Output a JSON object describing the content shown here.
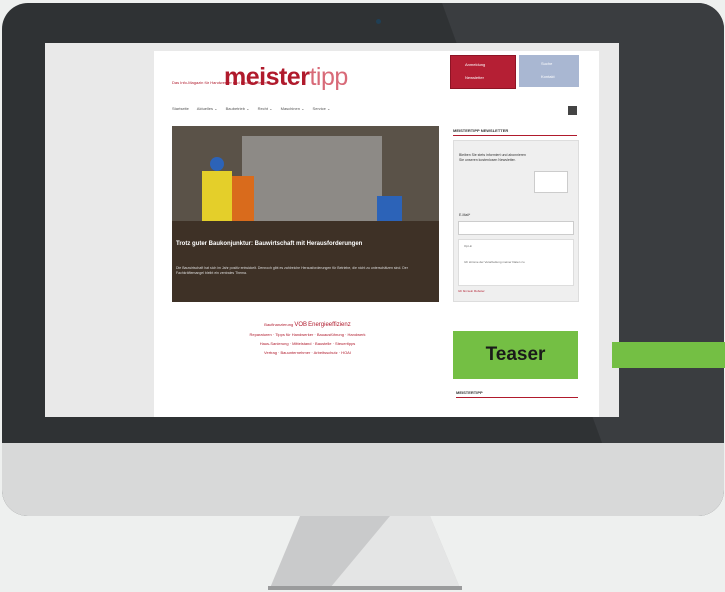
{
  "site": {
    "logo_part1": "meister",
    "logo_part2": "tipp",
    "tagline": "Das Info-Magazin für Handwerker und Bauunternehmer",
    "nav": [
      "Startseite",
      "Aktuelles ⌄",
      "Baubetrieb ⌄",
      "Recht ⌄",
      "Maschinen ⌄",
      "Service ⌄"
    ],
    "header_buttons_red": [
      "Anmeldung",
      "Newsletter"
    ],
    "header_buttons_blue": [
      "Suche",
      "Kontakt"
    ]
  },
  "hero": {
    "title": "Trotz guter Baukonjunktur: Bauwirtschaft mit Herausforderungen",
    "text": "Die Bauwirtschaft hat sich im Jahr positiv entwickelt. Dennoch gibt es zahlreiche Herausforderungen für Betriebe, die nicht zu unterschätzen sind. Der Fachkräftemangel bleibt ein zentrales Thema."
  },
  "tags": {
    "line1_a": "Baufinanzierung",
    "line1_b": "VOB",
    "line1_c": "Energieeffizienz",
    "line2": "Reparaturen · Tipps für Handwerker · Bauausführung · Handwerk",
    "line3": "Haus-Sanierung · Mittelstand · Baustelle · Steuertipps",
    "line4": "Vertrag · Bauunternehmer · Arbeitsschutz · HOAI"
  },
  "sidebar": {
    "heading": "MEISTERTIPP NEWSLETTER",
    "text": "Bleiben Sie stets informiert und abonnieren Sie unseren kostenlosen Newsletter.",
    "email_label": "E-Mail*",
    "consent_1": "Opt-in",
    "consent_2": "Ich stimme der Verarbeitung meiner Daten zu.",
    "captcha_text": "Ich bin kein Roboter",
    "footer_heading": "MEISTERTIPP"
  },
  "overlay": {
    "teaser_label": "Teaser"
  },
  "colors": {
    "brand": "#b01a2c",
    "teaser_green": "#74bf44",
    "bezel": "#2f3234"
  }
}
